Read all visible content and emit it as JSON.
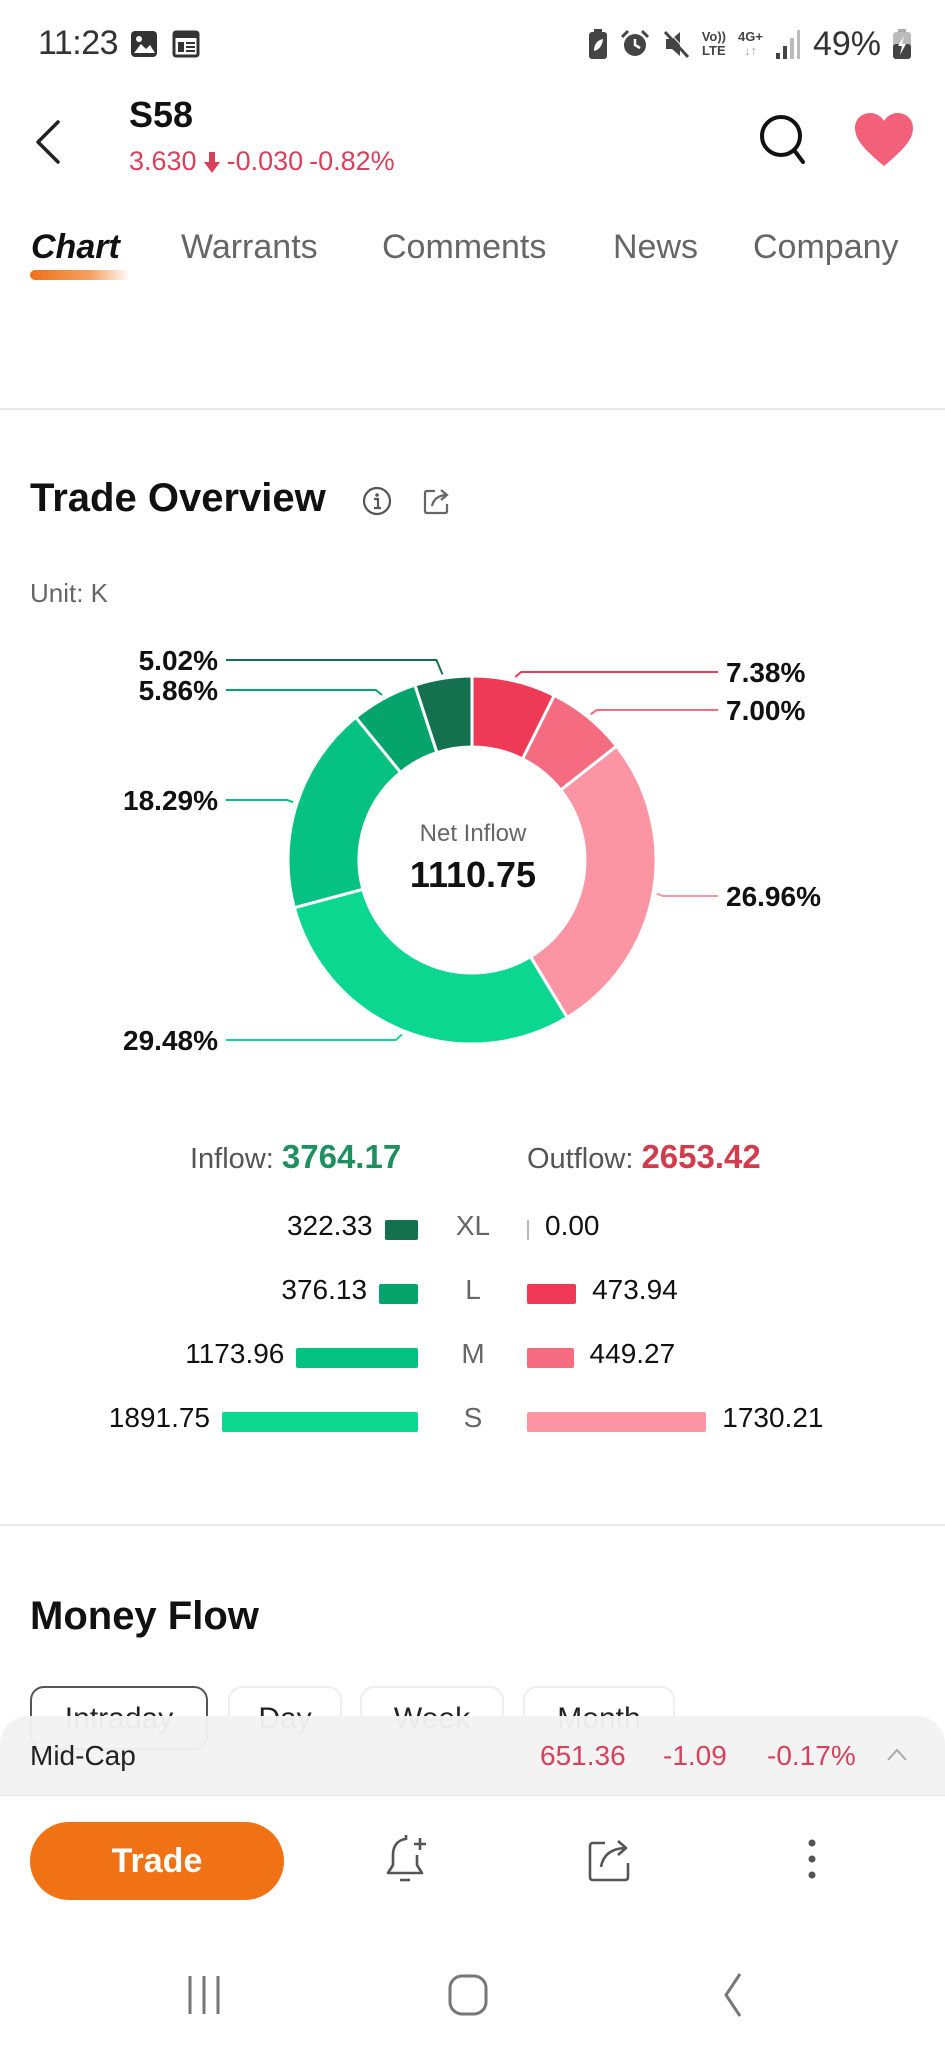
{
  "status_bar": {
    "time": "11:23",
    "left_icons": [
      "gallery-icon",
      "calendar-news-icon"
    ],
    "right_icons": [
      "battery-saver-icon",
      "alarm-icon",
      "mute-icon",
      "volte-icon",
      "4g-plus-icon",
      "signal-icon",
      "charging-battery-icon"
    ],
    "volte_line1": "Vo))",
    "volte_line2": "LTE",
    "network": "4G+",
    "network_arrows": "↓↑",
    "battery": "49%"
  },
  "header": {
    "ticker": "S58",
    "price": "3.630",
    "change": "-0.030",
    "change_pct": "-0.82%",
    "direction": "down",
    "colors": {
      "down": "#d9405a",
      "favorite": "#f2607a"
    }
  },
  "tabs": [
    {
      "label": "Chart",
      "active": true
    },
    {
      "label": "Warrants",
      "active": false
    },
    {
      "label": "Comments",
      "active": false
    },
    {
      "label": "News",
      "active": false
    },
    {
      "label": "Company",
      "active": false
    }
  ],
  "trade_overview": {
    "title": "Trade Overview",
    "unit": "Unit: K",
    "center_caption": "Net Inflow",
    "center_value": "1110.75",
    "inflow_label": "Inflow:",
    "inflow_value": "3764.17",
    "outflow_label": "Outflow:",
    "outflow_value": "2653.42",
    "rows": [
      {
        "category": "XL",
        "inflow": "322.33",
        "outflow": "0.00"
      },
      {
        "category": "L",
        "inflow": "376.13",
        "outflow": "473.94"
      },
      {
        "category": "M",
        "inflow": "1173.96",
        "outflow": "449.27"
      },
      {
        "category": "S",
        "inflow": "1891.75",
        "outflow": "1730.21"
      }
    ]
  },
  "chart_data": {
    "type": "pie",
    "donut": true,
    "title": "Trade Overview",
    "center_label": "Net Inflow",
    "center_value": 1110.75,
    "unit": "K",
    "slices": [
      {
        "name": "Outflow XL",
        "value": 0.0,
        "percent": 0.0,
        "color": "#e8e8e8"
      },
      {
        "name": "Outflow L",
        "value": 473.94,
        "percent": 7.38,
        "label": "7.38%",
        "color": "#ee3a57"
      },
      {
        "name": "Outflow M",
        "value": 449.27,
        "percent": 7.0,
        "label": "7.00%",
        "color": "#f56b80"
      },
      {
        "name": "Outflow S",
        "value": 1730.21,
        "percent": 26.96,
        "label": "26.96%",
        "color": "#fb94a3"
      },
      {
        "name": "Inflow S",
        "value": 1891.75,
        "percent": 29.48,
        "label": "29.48%",
        "color": "#0cd791"
      },
      {
        "name": "Inflow M",
        "value": 1173.96,
        "percent": 18.29,
        "label": "18.29%",
        "color": "#05c282"
      },
      {
        "name": "Inflow L",
        "value": 376.13,
        "percent": 5.86,
        "label": "5.86%",
        "color": "#04a46c"
      },
      {
        "name": "Inflow XL",
        "value": 322.33,
        "percent": 5.02,
        "label": "5.02%",
        "color": "#147150"
      }
    ],
    "bar_series": [
      {
        "name": "Inflow",
        "categories": [
          "XL",
          "L",
          "M",
          "S"
        ],
        "values": [
          322.33,
          376.13,
          1173.96,
          1891.75
        ],
        "colors": [
          "#147150",
          "#04a46c",
          "#05c282",
          "#0cd791"
        ]
      },
      {
        "name": "Outflow",
        "categories": [
          "XL",
          "L",
          "M",
          "S"
        ],
        "values": [
          0.0,
          473.94,
          449.27,
          1730.21
        ],
        "colors": [
          "#b0b8c8",
          "#ee3a57",
          "#f56b80",
          "#fb94a3"
        ]
      }
    ]
  },
  "money_flow": {
    "title": "Money Flow",
    "periods": [
      {
        "label": "Intraday",
        "active": true
      },
      {
        "label": "Day",
        "active": false
      },
      {
        "label": "Week",
        "active": false
      },
      {
        "label": "Month",
        "active": false
      }
    ]
  },
  "index_bar": {
    "name": "Mid-Cap",
    "value": "651.36",
    "change": "-1.09",
    "change_pct": "-0.17%"
  },
  "action_bar": {
    "trade_label": "Trade",
    "trade_color": "#f07214",
    "icons": [
      "add-alert-icon",
      "share-icon",
      "more-vertical-icon"
    ]
  },
  "nav_bar": {
    "buttons": [
      "recent-apps-icon",
      "home-icon",
      "back-icon"
    ]
  }
}
